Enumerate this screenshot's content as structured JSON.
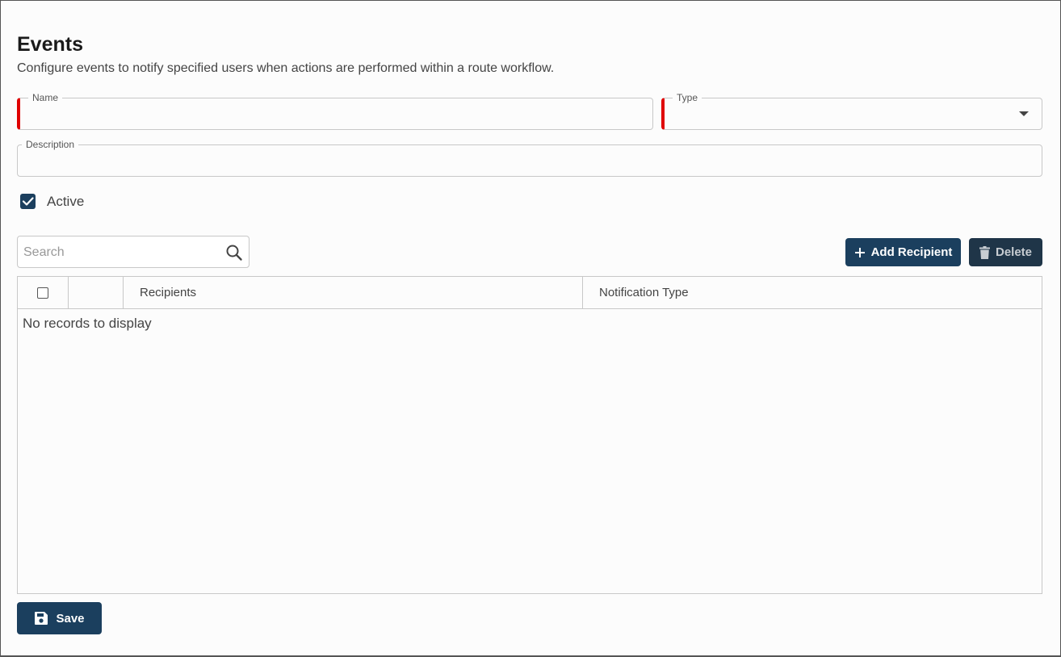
{
  "page": {
    "title": "Events",
    "subtitle": "Configure events to notify specified users when actions are performed within a route workflow."
  },
  "form": {
    "name": {
      "label": "Name",
      "value": ""
    },
    "type": {
      "label": "Type",
      "value": ""
    },
    "description": {
      "label": "Description",
      "value": ""
    },
    "active": {
      "label": "Active",
      "checked": true
    }
  },
  "toolbar": {
    "search_placeholder": "Search",
    "add_label": "Add Recipient",
    "delete_label": "Delete"
  },
  "table": {
    "columns": [
      "",
      "",
      "Recipients",
      "Notification Type"
    ],
    "empty_message": "No records to display",
    "rows": []
  },
  "footer": {
    "save_label": "Save"
  },
  "colors": {
    "primary": "#1b3f5e",
    "required": "#e00000"
  }
}
